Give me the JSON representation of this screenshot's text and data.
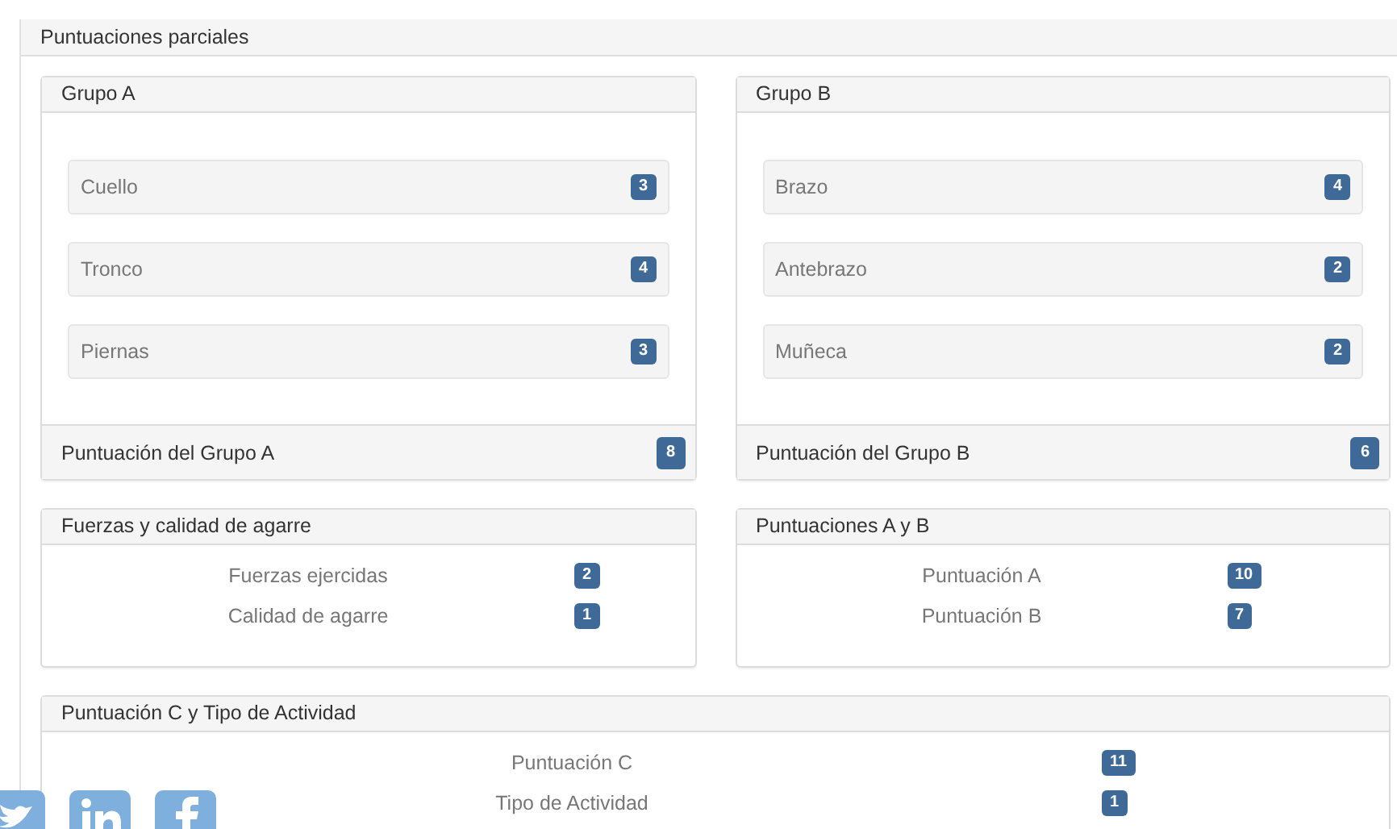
{
  "section_title": "Puntuaciones parciales",
  "groups": [
    {
      "title": "Grupo A",
      "items": [
        {
          "label": "Cuello",
          "score": "3"
        },
        {
          "label": "Tronco",
          "score": "4"
        },
        {
          "label": "Piernas",
          "score": "3"
        }
      ],
      "total_label": "Puntuación del Grupo A",
      "total": "8"
    },
    {
      "title": "Grupo B",
      "items": [
        {
          "label": "Brazo",
          "score": "4"
        },
        {
          "label": "Antebrazo",
          "score": "2"
        },
        {
          "label": "Muñeca",
          "score": "2"
        }
      ],
      "total_label": "Puntuación del Grupo B",
      "total": "6"
    }
  ],
  "summaries": [
    {
      "title": "Fuerzas y calidad de agarre",
      "rows": [
        {
          "label": "Fuerzas ejercidas",
          "score": "2"
        },
        {
          "label": "Calidad de agarre",
          "score": "1"
        }
      ]
    },
    {
      "title": "Puntuaciones A y B",
      "rows": [
        {
          "label": "Puntuación A",
          "score": "10"
        },
        {
          "label": "Puntuación B",
          "score": "7"
        }
      ]
    },
    {
      "title": "Puntuación C y Tipo de Actividad",
      "rows": [
        {
          "label": "Puntuación C",
          "score": "11"
        },
        {
          "label": "Tipo de Actividad",
          "score": "1"
        }
      ]
    }
  ],
  "share_buttons": [
    {
      "kind": "bird"
    },
    {
      "kind": "linkedin"
    },
    {
      "kind": "facebook"
    }
  ]
}
